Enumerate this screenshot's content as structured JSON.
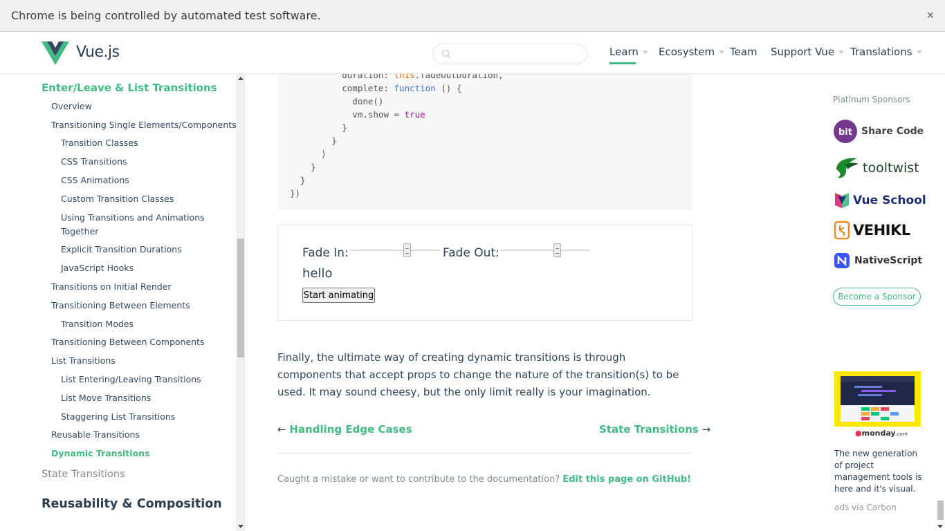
{
  "infobar": {
    "message": "Chrome is being controlled by automated test software.",
    "close_glyph": "×"
  },
  "header": {
    "logo_text": "Vue.js",
    "search_placeholder": "",
    "nav": [
      {
        "label": "Learn",
        "has_caret": true,
        "active": true
      },
      {
        "label": "Ecosystem",
        "has_caret": true
      },
      {
        "label": "Team",
        "has_caret": false
      },
      {
        "label": "Support Vue",
        "has_caret": true
      },
      {
        "label": "Translations",
        "has_caret": true
      }
    ]
  },
  "sidebar": {
    "section_title": "Enter/Leave & List Transitions",
    "items": [
      {
        "label": "Overview"
      },
      {
        "label": "Transitioning Single Elements/Components"
      },
      {
        "label": "Transition Classes"
      },
      {
        "label": "CSS Transitions"
      },
      {
        "label": "CSS Animations"
      },
      {
        "label": "Custom Transition Classes"
      },
      {
        "label": "Using Transitions and Animations"
      },
      {
        "label": "Together"
      },
      {
        "label": "Explicit Transition Durations"
      },
      {
        "label": "JavaScript Hooks"
      },
      {
        "label": "Transitions on Initial Render"
      },
      {
        "label": "Transitioning Between Elements"
      },
      {
        "label": "Transition Modes"
      },
      {
        "label": "Transitioning Between Components"
      },
      {
        "label": "List Transitions"
      },
      {
        "label": "List Entering/Leaving Transitions"
      },
      {
        "label": "List Move Transitions"
      },
      {
        "label": "Staggering List Transitions"
      },
      {
        "label": "Reusable Transitions"
      },
      {
        "label": "Dynamic Transitions"
      }
    ],
    "next_section": "State Transitions",
    "group_title": "Reusability & Composition"
  },
  "code": {
    "lines": [
      "          duration: this.fadeOutDuration,",
      "          complete: function () {",
      "            done()",
      "            vm.show = true",
      "          }",
      "        }",
      "      )",
      "    }",
      "  }",
      "})"
    ]
  },
  "demo": {
    "fade_in_label": "Fade In:",
    "fade_out_label": "Fade Out:",
    "fade_in_value_fraction": 0.65,
    "fade_out_value_fraction": 0.65,
    "hello_text": "hello",
    "button_label": "Start animating"
  },
  "content": {
    "paragraph": "Finally, the ultimate way of creating dynamic transitions is through components that accept props to change the nature of the transition(s) to be used. It may sound cheesy, but the only limit really is your imagination.",
    "prev_arrow": "←",
    "prev_label": "Handling Edge Cases",
    "next_label": "State Transitions",
    "next_arrow": "→",
    "footer_text": "Caught a mistake or want to contribute to the documentation?",
    "footer_link": "Edit this page on GitHub!"
  },
  "sponsors": {
    "title": "Platinum Sponsors",
    "list": [
      {
        "name": "Share Code",
        "badge": "bit",
        "color": "#73398d"
      },
      {
        "name": "tooltwist",
        "color": "#1a6b2a"
      },
      {
        "name": "Vue School",
        "color": "#1b2e75"
      },
      {
        "name": "VEHIKL",
        "color": "#111111"
      },
      {
        "name": "NativeScript",
        "color": "#3655ff"
      }
    ],
    "become_label": "Become a Sponsor"
  },
  "ad": {
    "brand": "monday",
    "brand_suffix": ".com",
    "copy": "The new generation of project management tools is here and it's visual.",
    "via": "ads via Carbon"
  },
  "colors": {
    "accent": "#42b983",
    "text": "#2c3e50",
    "code_bg": "#f8f8f8"
  }
}
